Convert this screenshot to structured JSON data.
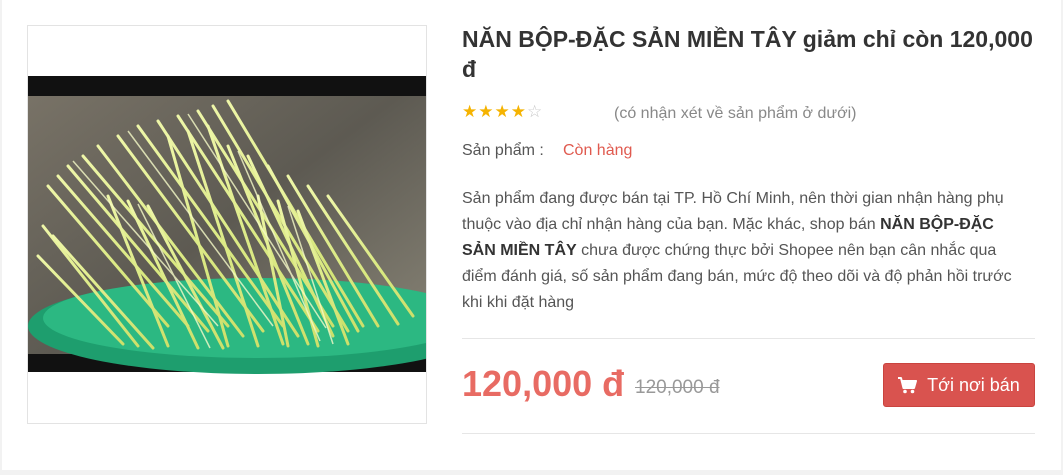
{
  "product": {
    "title": "NĂN BỘP-ĐẶC SẢN MIỀN TÂY giảm chỉ còn 120,000 đ",
    "rating": 4,
    "rating_max": 5,
    "review_note": "(có nhận xét về sản phẩm ở dưới)",
    "stock_label": "Sản phẩm :",
    "stock_value": "Còn hàng",
    "description": {
      "part1": "Sản phẩm đang được bán tại TP. Hồ Chí Minh, nên thời gian nhận hàng phụ thuộc vào địa chỉ nhận hàng của bạn. Mặc khác, shop bán ",
      "product_name": "NĂN BỘP-ĐẶC SẢN MIỀN TÂY",
      "part2": " chưa được chứng thực bởi Shopee nên bạn cân nhắc qua điểm đánh giá, số sản phẩm đang bán, mức độ theo dõi và độ phản hồi trước khi khi đặt hàng"
    },
    "price": "120,000 đ",
    "old_price": "120,000 đ",
    "buy_button": "Tới nơi bán",
    "buy_icon": "shopping-cart-icon"
  },
  "colors": {
    "price": "#e86b63",
    "stock": "#e05a4f",
    "button": "#d9534f",
    "star": "#f5b301"
  }
}
